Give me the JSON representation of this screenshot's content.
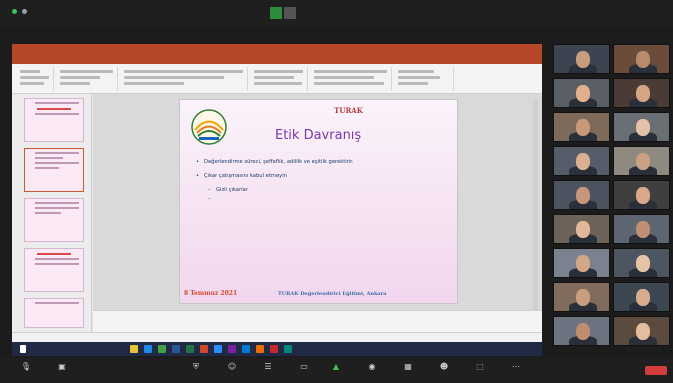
{
  "colors": {
    "share_banner": "#2d8c3c",
    "ppt_accent": "#b7472a",
    "title": "#7a3aa6",
    "org": "#b23a3a",
    "date": "#d24a2c",
    "end_button": "#d53c3c"
  },
  "slide": {
    "org": "TURAK",
    "title": "Etik Davranış",
    "bullets": [
      "Değerlendirme süreci, şeffaflık, adillik ve eşitlik gerektirir.",
      "Çıkar çatışmasını kabul etmeyin",
      "Gizli çıkarlar"
    ],
    "date": "8 Temmuz 2021",
    "footer": "TURAK Değerlendirici Eğitimi, Ankara"
  },
  "participants": [
    {
      "name": "",
      "face": "#c79c7f",
      "bg": "#3b4450"
    },
    {
      "name": "",
      "face": "#b98a6c",
      "bg": "#6b4c3a"
    },
    {
      "name": "",
      "face": "#e0b08d",
      "bg": "#5a5f66"
    },
    {
      "name": "",
      "face": "#d5a585",
      "bg": "#4a3b36"
    },
    {
      "name": "",
      "face": "#c9987a",
      "bg": "#7d6a5a"
    },
    {
      "name": "",
      "face": "#e3c2a8",
      "bg": "#6a6f76"
    },
    {
      "name": "",
      "face": "#d9b092",
      "bg": "#555d6a"
    },
    {
      "name": "",
      "face": "#caa184",
      "bg": "#8e8a7f"
    },
    {
      "name": "",
      "face": "#c6957a",
      "bg": "#4b5360"
    },
    {
      "name": "",
      "face": "#d7a98a",
      "bg": "#3f3f3f"
    },
    {
      "name": "",
      "face": "#e1b89a",
      "bg": "#6d6358"
    },
    {
      "name": "",
      "face": "#c08e72",
      "bg": "#5d6670"
    },
    {
      "name": "",
      "face": "#d3a688",
      "bg": "#7a8290"
    },
    {
      "name": "",
      "face": "#e6c4a8",
      "bg": "#4d5561"
    },
    {
      "name": "",
      "face": "#cb9d7f",
      "bg": "#806b5c"
    },
    {
      "name": "",
      "face": "#d8ad8f",
      "bg": "#3d4752"
    },
    {
      "name": "",
      "face": "#bf8d70",
      "bg": "#6b7480"
    },
    {
      "name": "",
      "face": "#e2bd9f",
      "bg": "#5b4a3e"
    }
  ]
}
